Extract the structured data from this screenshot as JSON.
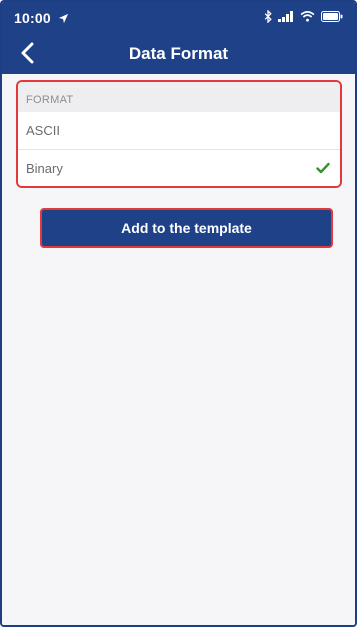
{
  "status_bar": {
    "time": "10:00",
    "location_icon": "location-arrow-icon",
    "bluetooth_icon": "bluetooth-icon",
    "signal_icon": "signal-bars-icon",
    "wifi_icon": "wifi-icon",
    "battery_icon": "battery-icon"
  },
  "nav": {
    "title": "Data Format",
    "back_icon": "chevron-left-icon"
  },
  "format_section": {
    "header": "FORMAT",
    "options": [
      {
        "label": "ASCII",
        "selected": false
      },
      {
        "label": "Binary",
        "selected": true
      }
    ]
  },
  "actions": {
    "add_label": "Add to the template"
  },
  "colors": {
    "brand_blue": "#1e4188",
    "highlight_red": "#e23a3a",
    "check_green": "#3a8f2f",
    "background": "#f6f6f8"
  }
}
